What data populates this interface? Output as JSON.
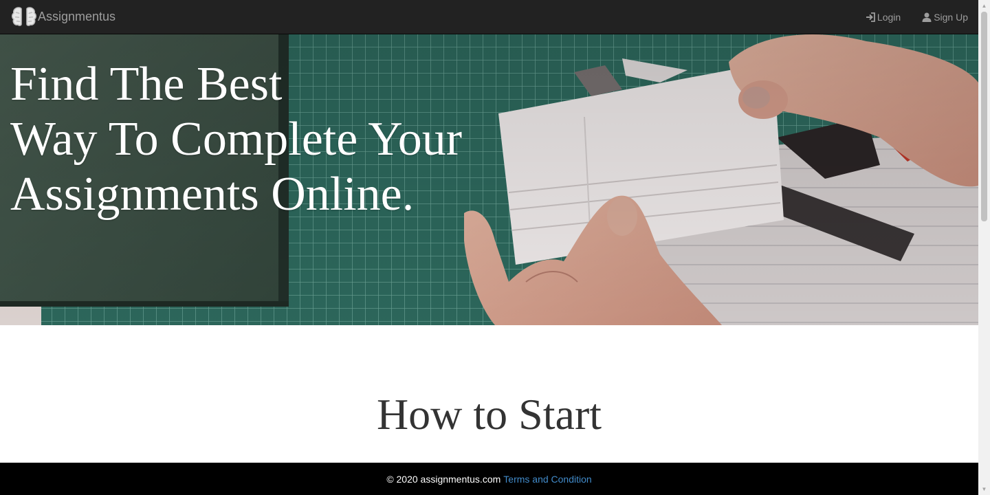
{
  "navbar": {
    "brand": "Assignmentus",
    "links": [
      {
        "label": "Login",
        "icon": "login-icon"
      },
      {
        "label": "Sign Up",
        "icon": "user-icon"
      }
    ]
  },
  "hero": {
    "title_lines": [
      "Find The Best",
      "Way To Complete Your",
      "Assignments Online."
    ],
    "image": "hands-folding-paper-on-cutting-mat"
  },
  "section": {
    "title": "How to Start"
  },
  "footer": {
    "copyright": "© 2020 assignmentus.com",
    "terms_link": "Terms and Condition"
  },
  "colors": {
    "navbar_bg": "#222222",
    "nav_text": "#9d9d9d",
    "footer_bg": "#000000",
    "link": "#428bca",
    "heading": "#333333"
  }
}
